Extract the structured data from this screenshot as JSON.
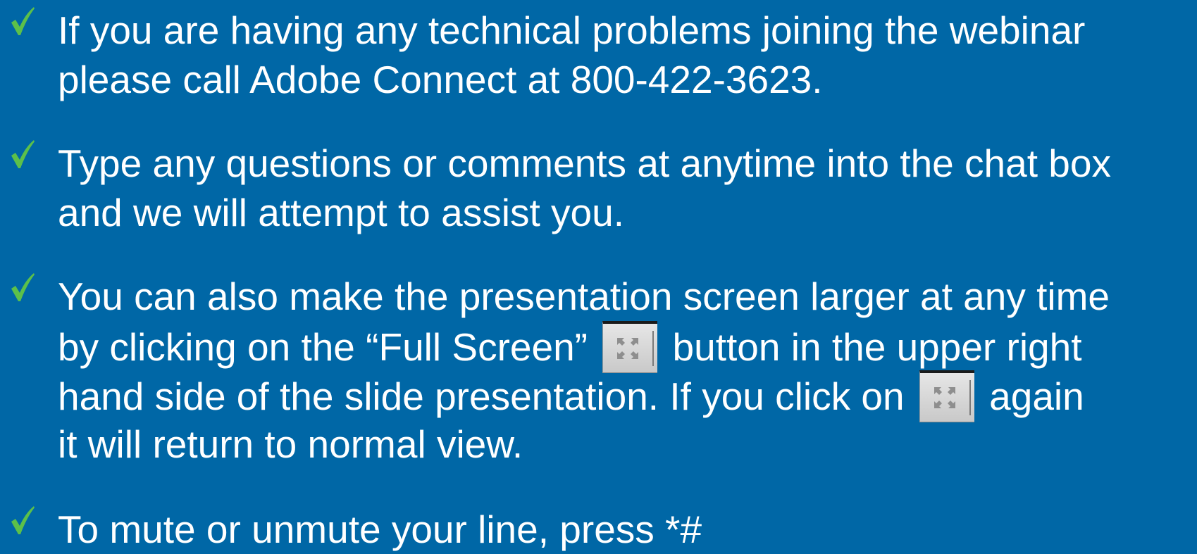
{
  "colors": {
    "background": "#0067a6",
    "text": "#ffffff",
    "check": "#5cc04a"
  },
  "icons": {
    "bullet": "checkmark-icon",
    "fullscreen": "fullscreen-expand-icon"
  },
  "bullets": [
    {
      "lines": [
        "If you are having any technical problems joining the webinar",
        "please call Adobe Connect at 800-422-3623."
      ]
    },
    {
      "lines": [
        "Type any questions or comments at anytime into the chat box",
        "and we will attempt to assist you."
      ]
    },
    {
      "line1": "You can also make the presentation screen larger at any time",
      "line2_before": "by clicking on the “Full Screen”",
      "line2_after": "button in the upper right",
      "line3_before": "hand side of the slide presentation.  If you click on",
      "line3_after": "again",
      "line4": "it will return to normal view."
    },
    {
      "lines": [
        "To mute or unmute your line, press *#"
      ]
    }
  ]
}
